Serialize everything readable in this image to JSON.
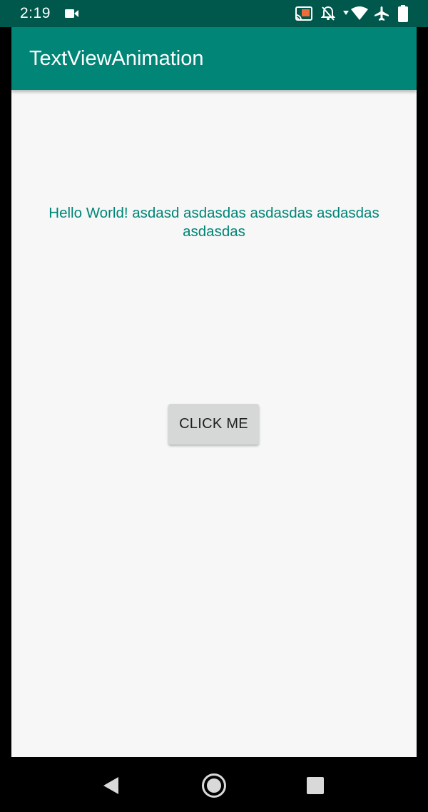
{
  "status_bar": {
    "time": "2:19",
    "icons": [
      "video-camera-icon",
      "cast-icon",
      "notifications-off-icon",
      "wifi-icon",
      "airplane-icon",
      "battery-icon"
    ],
    "background": "#00574b"
  },
  "app_bar": {
    "title": "TextViewAnimation",
    "background": "#008577"
  },
  "main": {
    "text": "Hello World! asdasd asdasdas asdasdas asdasdas asdasdas",
    "text_color": "#008577",
    "button_label": "CLICK ME"
  },
  "nav_bar": {
    "icons": [
      "back-icon",
      "home-icon",
      "recents-icon"
    ]
  }
}
